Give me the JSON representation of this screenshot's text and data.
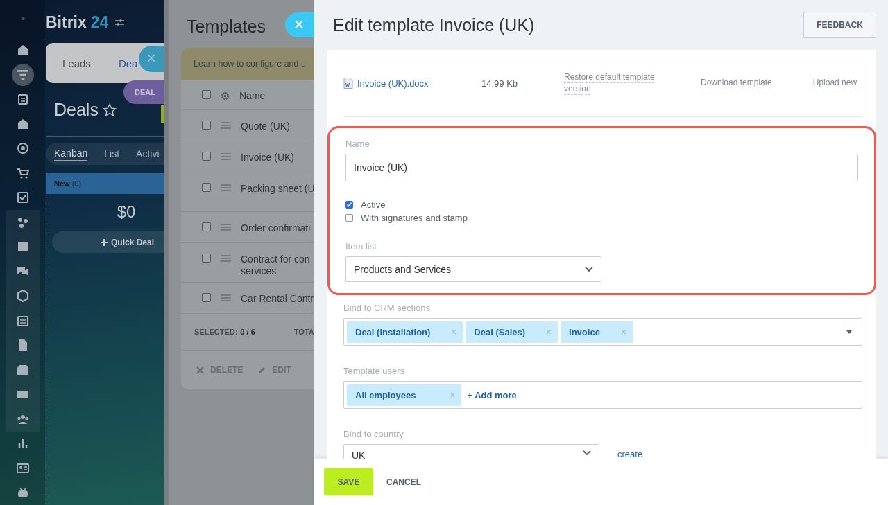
{
  "sidebar": {
    "items": [
      {
        "selected": false,
        "grouped": false
      },
      {
        "selected": true,
        "grouped": false
      },
      {
        "selected": false,
        "grouped": false
      },
      {
        "selected": false,
        "grouped": false
      },
      {
        "selected": false,
        "grouped": false
      },
      {
        "selected": false,
        "grouped": false
      },
      {
        "selected": false,
        "grouped": false
      },
      {
        "selected": false,
        "grouped": true
      },
      {
        "selected": false,
        "grouped": true
      },
      {
        "selected": false,
        "grouped": true
      },
      {
        "selected": false,
        "grouped": true
      },
      {
        "selected": false,
        "grouped": true
      },
      {
        "selected": false,
        "grouped": true
      },
      {
        "selected": false,
        "grouped": true
      },
      {
        "selected": false,
        "grouped": true
      },
      {
        "selected": false,
        "grouped": true
      },
      {
        "selected": false,
        "grouped": false
      },
      {
        "selected": false,
        "grouped": false
      },
      {
        "selected": false,
        "grouped": false
      }
    ]
  },
  "crm": {
    "logo_name": "Bitrix",
    "logo_number": "24",
    "top_tabs": [
      {
        "label": "Leads",
        "selected": false
      },
      {
        "label": "Dea",
        "selected": true
      }
    ],
    "badge": "DEAL",
    "title": "Deals",
    "view_tabs": [
      {
        "label": "Kanban",
        "selected": true
      },
      {
        "label": "List",
        "selected": false
      },
      {
        "label": "Activi",
        "selected": false
      }
    ],
    "column": {
      "name": "New",
      "count": "(0)",
      "sum": "$0",
      "quick_deal": "Quick Deal"
    }
  },
  "templates": {
    "title": "Templates",
    "banner": "Learn how to configure and u",
    "header": "Name",
    "header_checked": false,
    "rows": [
      {
        "lines": [
          "Quote (UK)"
        ],
        "checked": false
      },
      {
        "lines": [
          "Invoice (UK)"
        ],
        "checked": false
      },
      {
        "lines": [
          "Packing sheet (U"
        ],
        "checked": false
      },
      {
        "lines": [
          "Order confirmati"
        ],
        "checked": false
      },
      {
        "lines": [
          "Contract for con",
          "services"
        ],
        "checked": false
      },
      {
        "lines": [
          "Car Rental Contr"
        ],
        "checked": false
      }
    ],
    "selected_label": "SELECTED:",
    "selected_value": "0 / 6",
    "total_label": "TOTA",
    "actions": [
      "DELETE",
      "EDIT"
    ]
  },
  "editor": {
    "title": "Edit template Invoice (UK)",
    "feedback": "FEEDBACK",
    "file": {
      "name": "Invoice (UK).docx",
      "size": "14.99 Kb",
      "restore": "Restore default template version",
      "download": "Download template",
      "upload": "Upload new"
    },
    "name_label": "Name",
    "name_value": "Invoice (UK)",
    "checkboxes": [
      {
        "label": "Active",
        "checked": true
      },
      {
        "label": "With signatures and stamp",
        "checked": false
      }
    ],
    "item_list_label": "Item list",
    "item_list_value": "Products and Services",
    "crm_label": "Bind to CRM sections",
    "crm_tags": [
      "Deal (Installation)",
      "Deal (Sales)",
      "Invoice"
    ],
    "users_label": "Template users",
    "users_tags": [
      "All employees"
    ],
    "add_more": "+ Add more",
    "country_label": "Bind to country",
    "country_value": "UK",
    "create": "create",
    "save": "SAVE",
    "cancel": "CANCEL"
  }
}
